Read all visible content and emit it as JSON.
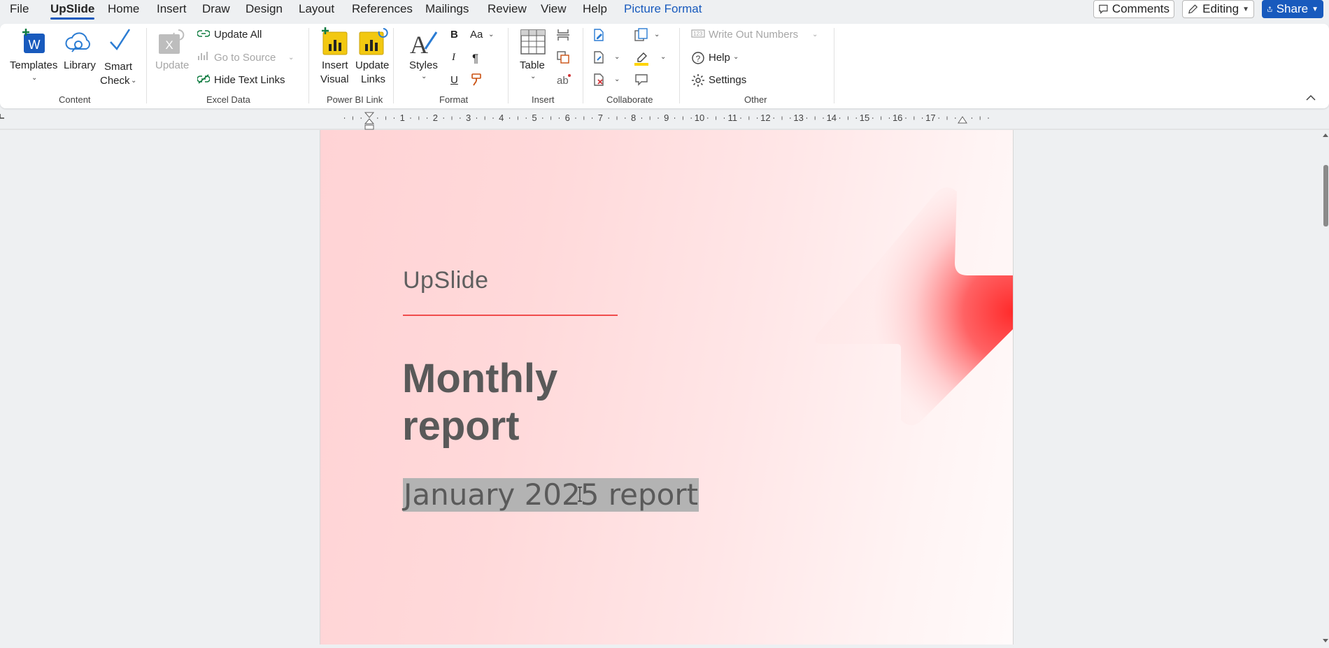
{
  "menu": {
    "items": [
      "File",
      "UpSlide",
      "Home",
      "Insert",
      "Draw",
      "Design",
      "Layout",
      "References",
      "Mailings",
      "Review",
      "View",
      "Help",
      "Picture Format"
    ],
    "active": "UpSlide",
    "comments_label": "Comments",
    "editing_label": "Editing",
    "share_label": "Share"
  },
  "ribbon": {
    "content": {
      "templates": "Templates",
      "library": "Library",
      "smart_check_1": "Smart",
      "smart_check_2": "Check",
      "group": "Content"
    },
    "excel": {
      "update": "Update",
      "update_all": "Update All",
      "go_to_source": "Go to Source",
      "hide_text_links": "Hide Text Links",
      "group": "Excel Data"
    },
    "powerbi": {
      "insert_visual_1": "Insert",
      "insert_visual_2": "Visual",
      "update_links_1": "Update",
      "update_links_2": "Links",
      "group": "Power BI Link"
    },
    "format": {
      "styles": "Styles",
      "bold": "B",
      "italic": "I",
      "underline": "U",
      "font_size": "Aa",
      "pilcrow": "¶",
      "group": "Format"
    },
    "insert": {
      "table": "Table",
      "group": "Insert"
    },
    "collaborate": {
      "group": "Collaborate"
    },
    "other": {
      "write_out_numbers": "Write Out Numbers",
      "help": "Help",
      "settings": "Settings",
      "group": "Other"
    }
  },
  "ruler": {
    "numbers": [
      "1",
      "2",
      "3",
      "4",
      "5",
      "6",
      "7",
      "8",
      "9",
      "10",
      "11",
      "12",
      "13",
      "14",
      "15",
      "16",
      "17"
    ]
  },
  "document": {
    "brand": "UpSlide",
    "title_line1": "Monthly",
    "title_line2": "report",
    "subtitle": "January 2025 report"
  },
  "colors": {
    "accent_blue": "#185abd",
    "brand_red": "#ff2d2d",
    "powerbi_yellow": "#f2c811",
    "title_gray": "#595959"
  }
}
